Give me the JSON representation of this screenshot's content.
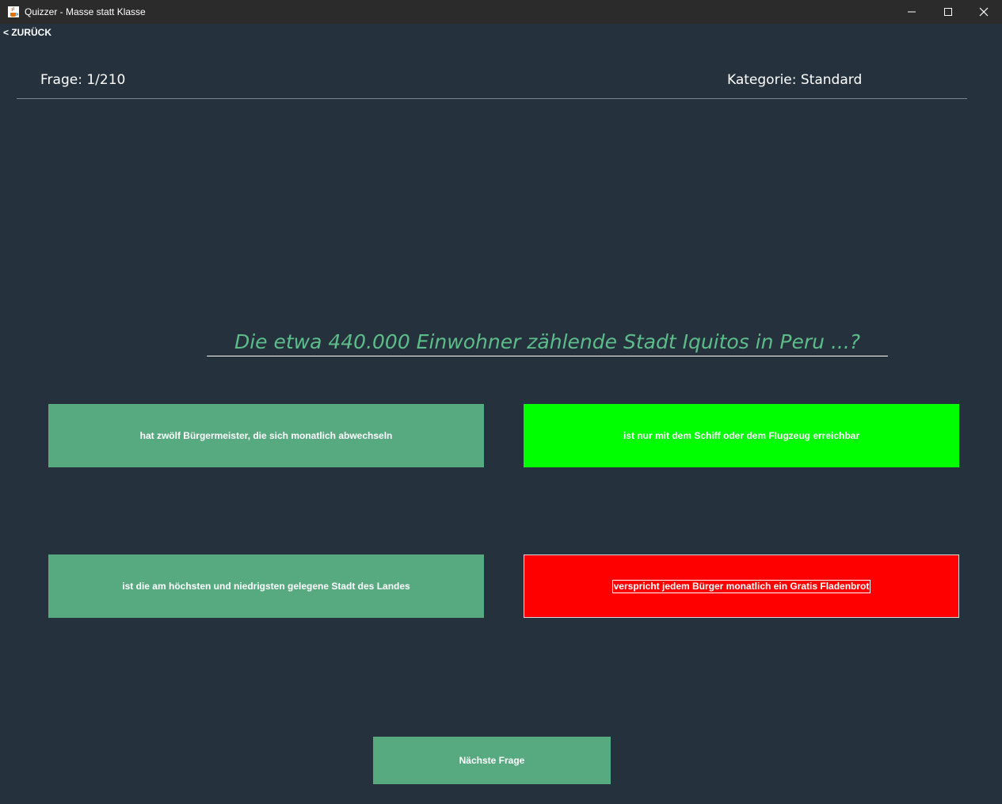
{
  "window": {
    "title": "Quizzer - Masse statt Klasse",
    "app_icon": "java-cup-icon",
    "controls": [
      "minimize-icon",
      "maximize-icon",
      "close-icon"
    ]
  },
  "nav": {
    "back_label": "< ZURÜCK"
  },
  "header": {
    "frage_label": "Frage:",
    "frage_value": "1/210",
    "kategorie_label": "Kategorie:",
    "kategorie_value": "Standard"
  },
  "question": {
    "text": "Die etwa 440.000 Einwohner zählende Stadt Iquitos in Peru ...?"
  },
  "answers": [
    {
      "label": "hat zwölf Bürgermeister, die sich monatlich abwechseln",
      "color": "#57aa80",
      "state": "neutral"
    },
    {
      "label": "ist nur mit dem Schiff oder dem Flugzeug erreichbar",
      "color": "#00ff00",
      "state": "correct"
    },
    {
      "label": "ist die am höchsten und niedrigsten gelegene Stadt des Landes",
      "color": "#57aa80",
      "state": "neutral"
    },
    {
      "label": "verspricht jedem Bürger monatlich ein Gratis Fladenbrot",
      "color": "#ff0000",
      "state": "wrong-selected"
    }
  ],
  "next_button": {
    "label": "Nächste Frage",
    "color": "#57aa80"
  },
  "colors": {
    "background": "#25323d",
    "titlebar": "#2b2b2b",
    "question_text": "#5dbd8a"
  }
}
